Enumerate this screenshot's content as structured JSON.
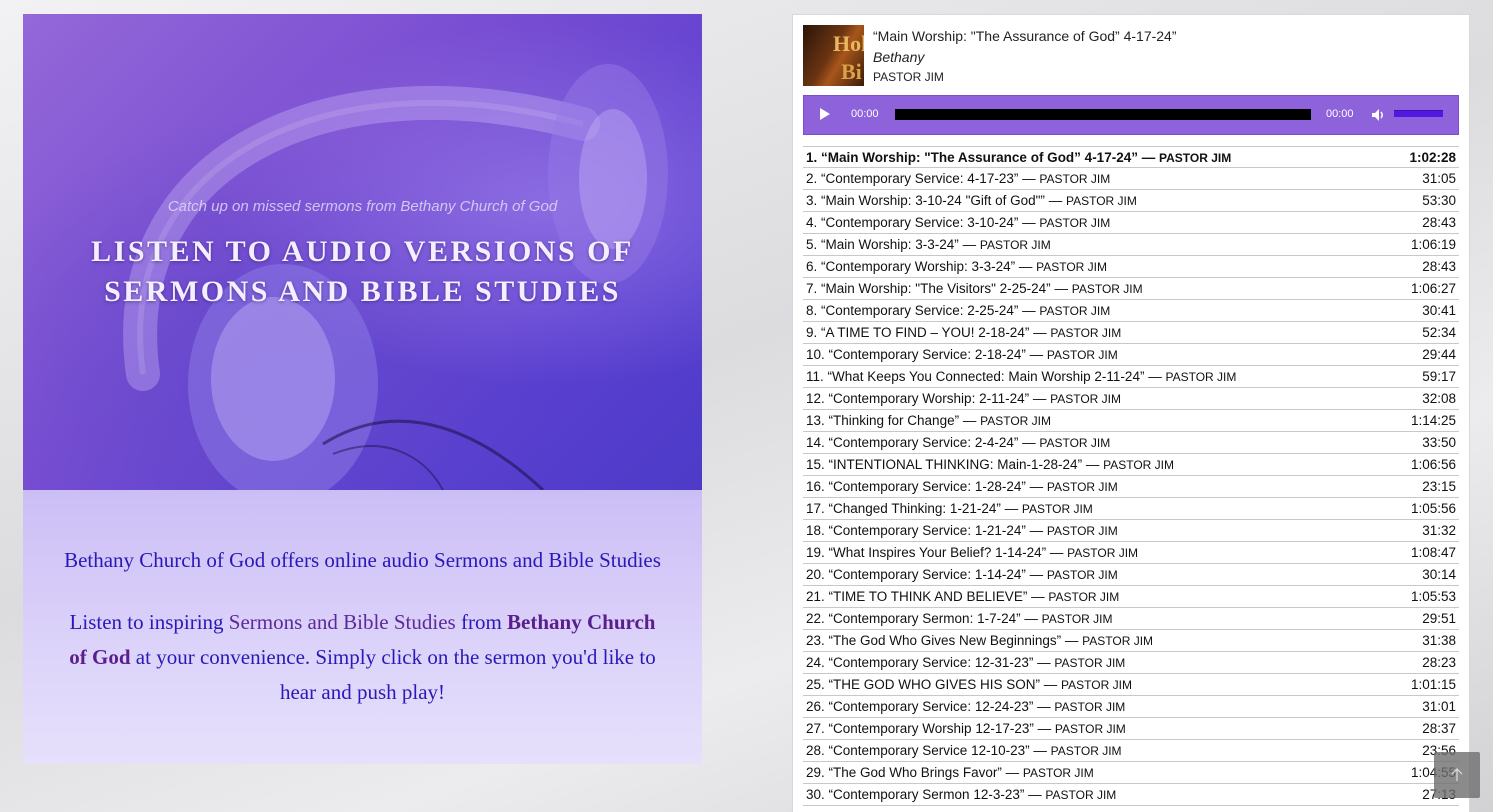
{
  "hero": {
    "tagline": "Catch up on missed sermons from Bethany Church of God",
    "headline": "LISTEN TO AUDIO VERSIONS OF SERMONS AND BIBLE STUDIES",
    "image_icon": "headphones-image"
  },
  "intro": {
    "line1": "Bethany Church of God offers online audio Sermons and Bible Studies",
    "p2_a": "Listen to inspiring ",
    "p2_b": "Sermons and Bible Studies",
    "p2_c": " from ",
    "p2_d": "Bethany Church of God",
    "p2_e": " at your convenience. Simply click on the sermon you'd like to hear and push play!"
  },
  "player": {
    "now_playing": {
      "title": "“Main Worship: \"The Assurance of God” 4-17-24”",
      "album": "Bethany",
      "artist": "PASTOR JIM",
      "cover_text_1": "Hol",
      "cover_text_2": "Bi"
    },
    "controls": {
      "current_time": "00:00",
      "duration": "00:00",
      "play_icon": "play-icon",
      "volume_icon": "volume-icon",
      "progress": 0,
      "volume_level": 1.0
    },
    "accent_color": "#8d62da",
    "tracks": [
      {
        "title": "1. “Main Worship: \"The Assurance of God” 4-17-24”",
        "artist": "PASTOR JIM",
        "duration": "1:02:28",
        "active": true
      },
      {
        "title": "2. “Contemporary Service: 4-17-23”",
        "artist": "PASTOR JIM",
        "duration": "31:05"
      },
      {
        "title": "3. “Main Worship: 3-10-24 \"Gift of God\"”",
        "artist": "PASTOR JIM",
        "duration": "53:30"
      },
      {
        "title": "4. “Contemporary Service: 3-10-24”",
        "artist": "PASTOR JIM",
        "duration": "28:43"
      },
      {
        "title": "5. “Main Worship: 3-3-24”",
        "artist": "PASTOR JIM",
        "duration": "1:06:19"
      },
      {
        "title": "6. “Contemporary Worship: 3-3-24”",
        "artist": "PASTOR JIM",
        "duration": "28:43"
      },
      {
        "title": "7. “Main Worship: \"The Visitors\" 2-25-24”",
        "artist": "PASTOR JIM",
        "duration": "1:06:27"
      },
      {
        "title": "8. “Contemporary Service: 2-25-24”",
        "artist": "PASTOR JIM",
        "duration": "30:41"
      },
      {
        "title": "9. “A TIME TO FIND – YOU! 2-18-24”",
        "artist": "PASTOR JIM",
        "duration": "52:34"
      },
      {
        "title": "10. “Contemporary Service: 2-18-24”",
        "artist": "PASTOR JIM",
        "duration": "29:44"
      },
      {
        "title": "11. “What Keeps You Connected: Main Worship 2-11-24”",
        "artist": "PASTOR JIM",
        "duration": "59:17"
      },
      {
        "title": "12. “Contemporary Worship: 2-11-24”",
        "artist": "PASTOR JIM",
        "duration": "32:08"
      },
      {
        "title": "13. “Thinking for Change”",
        "artist": "PASTOR JIM",
        "duration": "1:14:25"
      },
      {
        "title": "14. “Contemporary Service: 2-4-24”",
        "artist": "PASTOR JIM",
        "duration": "33:50"
      },
      {
        "title": "15. “INTENTIONAL THINKING: Main-1-28-24”",
        "artist": "PASTOR JIM",
        "duration": "1:06:56"
      },
      {
        "title": "16. “Contemporary Service: 1-28-24”",
        "artist": "PASTOR JIM",
        "duration": "23:15"
      },
      {
        "title": "17. “Changed Thinking: 1-21-24”",
        "artist": "PASTOR JIM",
        "duration": "1:05:56"
      },
      {
        "title": "18. “Contemporary Service: 1-21-24”",
        "artist": "PASTOR JIM",
        "duration": "31:32"
      },
      {
        "title": "19. “What Inspires Your Belief? 1-14-24”",
        "artist": "PASTOR JIM",
        "duration": "1:08:47"
      },
      {
        "title": "20. “Contemporary Service: 1-14-24”",
        "artist": "PASTOR JIM",
        "duration": "30:14"
      },
      {
        "title": "21. “TIME TO THINK AND BELIEVE”",
        "artist": "PASTOR JIM",
        "duration": "1:05:53"
      },
      {
        "title": "22. “Contemporary Sermon: 1-7-24”",
        "artist": "PASTOR JIM",
        "duration": "29:51"
      },
      {
        "title": "23. “The God Who Gives New Beginnings”",
        "artist": "PASTOR JIM",
        "duration": "31:38"
      },
      {
        "title": "24. “Contemporary Service: 12-31-23”",
        "artist": "PASTOR JIM",
        "duration": "28:23"
      },
      {
        "title": "25. “THE GOD WHO GIVES HIS SON”",
        "artist": "PASTOR JIM",
        "duration": "1:01:15"
      },
      {
        "title": "26. “Contemporary Service: 12-24-23”",
        "artist": "PASTOR JIM",
        "duration": "31:01"
      },
      {
        "title": "27. “Contemporary Worship 12-17-23”",
        "artist": "PASTOR JIM",
        "duration": "28:37"
      },
      {
        "title": "28. “Contemporary Service 12-10-23”",
        "artist": "PASTOR JIM",
        "duration": "23:56"
      },
      {
        "title": "29. “The God Who Brings Favor”",
        "artist": "PASTOR JIM",
        "duration": "1:04:55"
      },
      {
        "title": "30. “Contemporary Sermon 12-3-23”",
        "artist": "PASTOR JIM",
        "duration": "27:13"
      }
    ]
  },
  "scroll_top": {
    "icon": "arrow-up-icon"
  }
}
